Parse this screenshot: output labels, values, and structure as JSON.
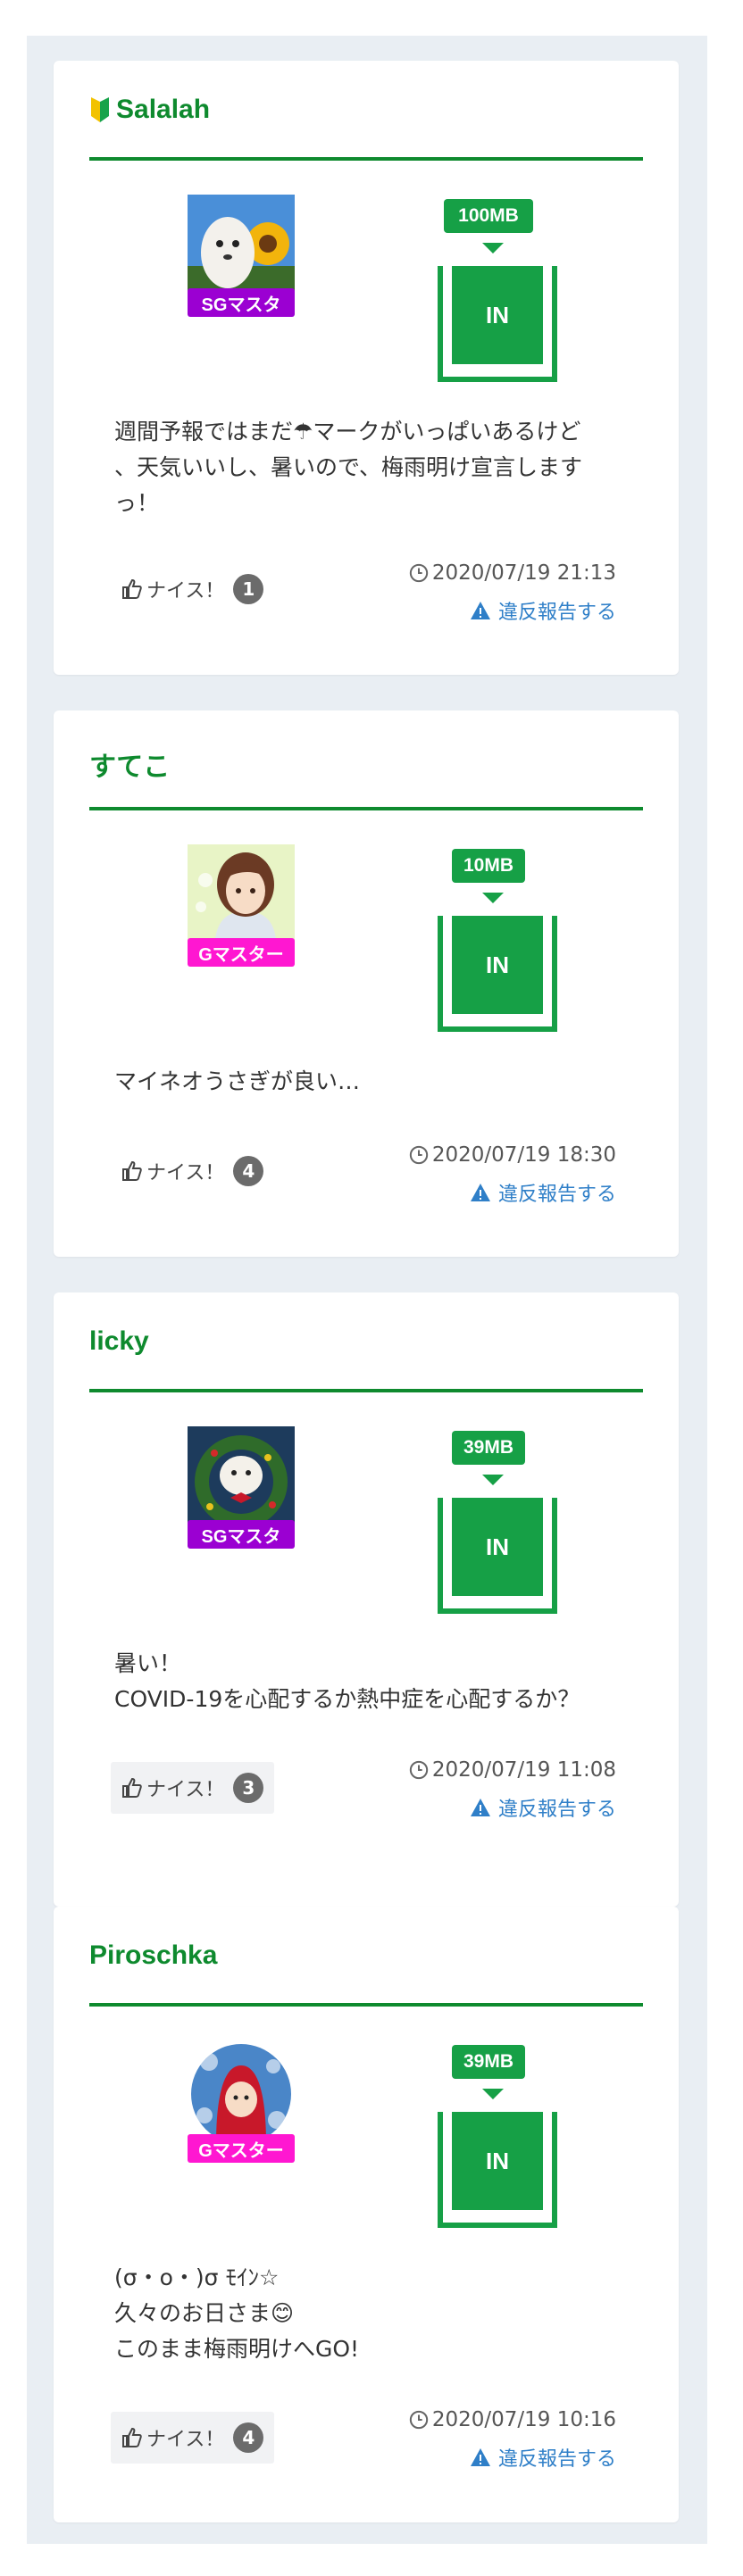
{
  "posts": [
    {
      "username": "Salalah",
      "beginner_mark": true,
      "rank": "SGマスタ",
      "rank_color": "#9b00d2",
      "data_size": "100MB",
      "direction": "IN",
      "message": "週間予報ではまだ☂マークがいっぱいあるけど\n、天気いいし、暑いので、梅雨明け宣言します\nっ！",
      "nice_label": "ナイス！",
      "nice_count": "1",
      "timestamp": "2020/07/19 21:13",
      "report_label": "違反報告する"
    },
    {
      "username": "すてこ",
      "beginner_mark": false,
      "rank": "Gマスター",
      "rank_color": "#ff17d1",
      "data_size": "10MB",
      "direction": "IN",
      "message": "マイネオうさぎが良い…",
      "nice_label": "ナイス！",
      "nice_count": "4",
      "timestamp": "2020/07/19 18:30",
      "report_label": "違反報告する"
    },
    {
      "username": "licky",
      "beginner_mark": false,
      "rank": "SGマスタ",
      "rank_color": "#9b00d2",
      "data_size": "39MB",
      "direction": "IN",
      "message": "暑い！\nCOVID-19を心配するか熱中症を心配するか？",
      "nice_label": "ナイス！",
      "nice_count": "3",
      "timestamp": "2020/07/19 11:08",
      "report_label": "違反報告する"
    },
    {
      "username": "Piroschka",
      "beginner_mark": false,
      "rank": "Gマスター",
      "rank_color": "#ff17d1",
      "data_size": "39MB",
      "direction": "IN",
      "message": "(σ・o・)σ ﾓｲﾝ☆\n久々のお日さま😊\nこのまま梅雨明けへGO!",
      "nice_label": "ナイス！",
      "nice_count": "4",
      "timestamp": "2020/07/19 10:16",
      "report_label": "違反報告する"
    }
  ]
}
